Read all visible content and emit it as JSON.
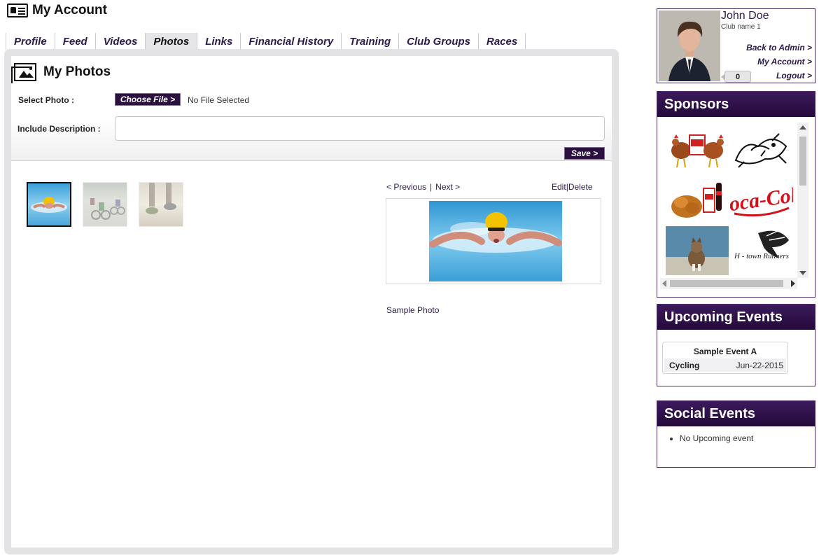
{
  "header": {
    "title": "My Account"
  },
  "tabs": [
    {
      "label": "Profile",
      "active": false
    },
    {
      "label": "Feed",
      "active": false
    },
    {
      "label": "Videos",
      "active": false
    },
    {
      "label": "Photos",
      "active": true
    },
    {
      "label": "Links",
      "active": false
    },
    {
      "label": "Financial History",
      "active": false
    },
    {
      "label": "Training",
      "active": false
    },
    {
      "label": "Club Groups",
      "active": false
    },
    {
      "label": "Races",
      "active": false
    }
  ],
  "photos": {
    "title": "My Photos",
    "select_label": "Select Photo :",
    "choose_button": "Choose File >",
    "file_status": "No File Selected",
    "description_label": "Include Description :",
    "description_value": "",
    "save_button": "Save >",
    "thumbnails": [
      {
        "subject": "swimmer",
        "selected": true
      },
      {
        "subject": "cyclists",
        "selected": false
      },
      {
        "subject": "runners",
        "selected": false
      }
    ],
    "nav": {
      "previous": "< Previous",
      "separator": "|",
      "next": "Next >"
    },
    "edit": "Edit",
    "delete": "Delete",
    "edit_sep": "|",
    "caption": "Sample Photo"
  },
  "profile": {
    "name": "John Doe",
    "club": "Club name 1",
    "links": [
      "Back to Admin >",
      "My Account >",
      "Logout >"
    ],
    "notification_count": "0"
  },
  "sponsors": {
    "title": "Sponsors",
    "items": [
      {
        "name": "chicken-sponsor"
      },
      {
        "name": "cartoon-sponsor"
      },
      {
        "name": "kfc-food-sponsor"
      },
      {
        "name": "coca-cola-sponsor",
        "text": "Coca-Cola"
      },
      {
        "name": "cat-sponsor"
      },
      {
        "name": "h-town-runners-sponsor",
        "text": "H - town Runners"
      }
    ]
  },
  "events": {
    "title": "Upcoming Events",
    "items": [
      {
        "name": "Sample Event A",
        "type": "Cycling",
        "date": "Jun-22-2015"
      }
    ]
  },
  "social": {
    "title": "Social Events",
    "items": [
      "No Upcoming event"
    ]
  },
  "colors": {
    "brand": "#2b1040",
    "link": "#2b1a4a",
    "panel_border": "#e3e3e6"
  }
}
